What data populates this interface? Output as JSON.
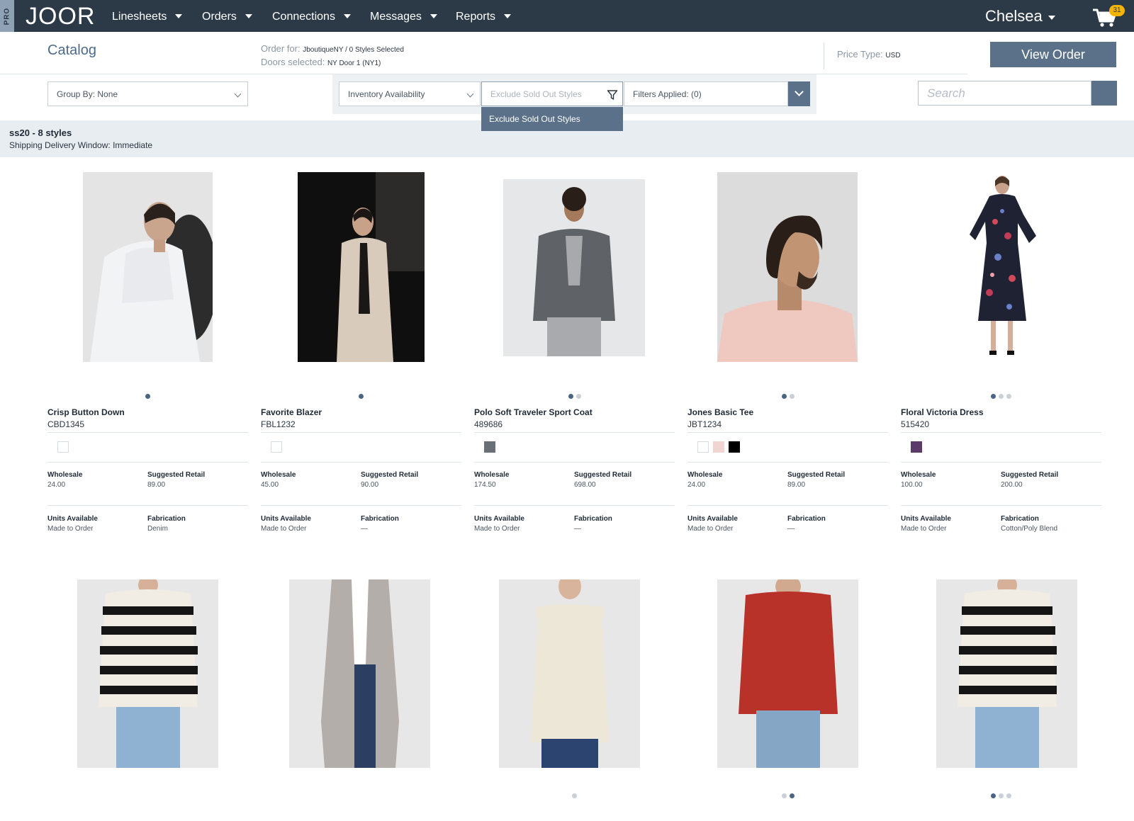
{
  "nav": {
    "pro": "PRO",
    "logo": "JOOR",
    "items": [
      {
        "label": "Linesheets"
      },
      {
        "label": "Orders"
      },
      {
        "label": "Connections"
      },
      {
        "label": "Messages"
      },
      {
        "label": "Reports"
      }
    ],
    "user": "Chelsea",
    "cart_count": "31",
    "icons": [
      "cart-icon",
      "caret-down-icon"
    ]
  },
  "header": {
    "title": "Catalog",
    "order_for_label": "Order for:",
    "order_for_value": "JboutiqueNY / 0 Styles Selected",
    "doors_label": "Doors selected:",
    "doors_value": "NY Door 1 (NY1)",
    "price_type_label": "Price Type:",
    "price_type_value": "USD",
    "view_order": "View Order"
  },
  "filters": {
    "group_by": "Group By: None",
    "inventory": "Inventory Availability",
    "exclude_placeholder": "Exclude Sold Out Styles",
    "applied": "Filters Applied: (0)",
    "dropdown_option": "Exclude Sold Out Styles",
    "search_placeholder": "Search"
  },
  "group": {
    "title": "ss20 - 8 styles",
    "subtitle": "Shipping Delivery Window: Immediate"
  },
  "labels": {
    "wholesale": "Wholesale",
    "suggested_retail": "Suggested Retail",
    "units_available": "Units Available",
    "fabrication": "Fabrication"
  },
  "products": [
    {
      "name": "Crisp Button Down",
      "code": "CBD1345",
      "wholesale": "24.00",
      "retail": "89.00",
      "units": "Made to Order",
      "fabrication": "Denim",
      "swatches": [
        "#ffffff"
      ],
      "dots": 1,
      "active_dot": 0
    },
    {
      "name": "Favorite Blazer",
      "code": "FBL1232",
      "wholesale": "45.00",
      "retail": "90.00",
      "units": "Made to Order",
      "fabrication": "—",
      "swatches": [
        "#ffffff"
      ],
      "dots": 1,
      "active_dot": 0
    },
    {
      "name": "Polo Soft Traveler Sport Coat",
      "code": "489686",
      "wholesale": "174.50",
      "retail": "698.00",
      "units": "Made to Order",
      "fabrication": "—",
      "swatches": [
        "#6a6f75"
      ],
      "dots": 2,
      "active_dot": 0
    },
    {
      "name": "Jones Basic Tee",
      "code": "JBT1234",
      "wholesale": "24.00",
      "retail": "89.00",
      "units": "Made to Order",
      "fabrication": "—",
      "swatches": [
        "#ffffff",
        "#f1d5d3",
        "#000000"
      ],
      "dots": 2,
      "active_dot": 0
    },
    {
      "name": "Floral Victoria Dress",
      "code": "515420",
      "wholesale": "100.00",
      "retail": "200.00",
      "units": "Made to Order",
      "fabrication": "Cotton/Poly Blend",
      "swatches": [
        "#5b3a6a"
      ],
      "dots": 3,
      "active_dot": 0
    }
  ],
  "row2": [
    {
      "dots": 0,
      "active_dot": -1
    },
    {
      "dots": 0,
      "active_dot": -1
    },
    {
      "dots": 1,
      "active_dot": -1
    },
    {
      "dots": 2,
      "active_dot": 1
    },
    {
      "dots": 3,
      "active_dot": 0
    }
  ],
  "colors": {
    "nav": "#2c3a48",
    "accent": "#5a7189",
    "band": "#e8edf1"
  }
}
